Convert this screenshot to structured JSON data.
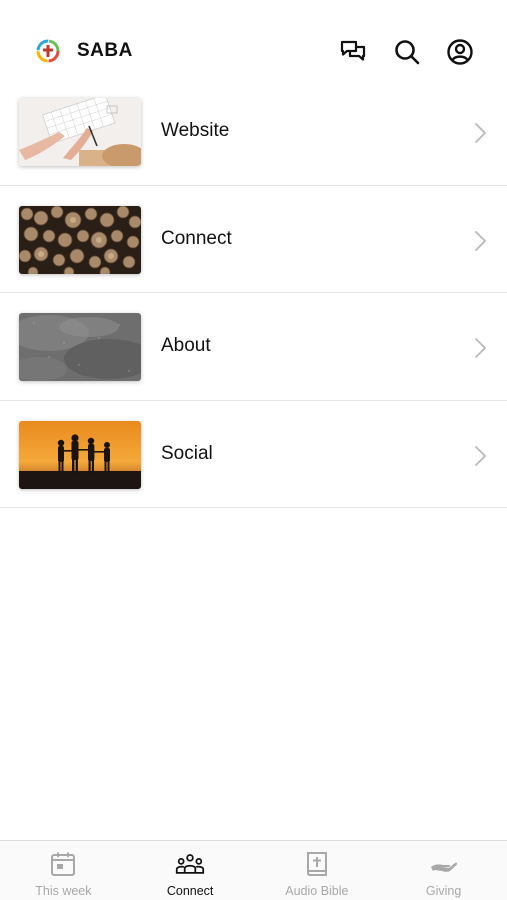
{
  "header": {
    "brand": "SABA",
    "icons": [
      "chat-icon",
      "search-icon",
      "profile-icon"
    ]
  },
  "menu": {
    "items": [
      {
        "label": "Website",
        "image": "hands-typing-keyboard-photo"
      },
      {
        "label": "Connect",
        "image": "stacked-logs-photo"
      },
      {
        "label": "About",
        "image": "gray-stone-texture-photo"
      },
      {
        "label": "Social",
        "image": "family-silhouette-sunset-photo"
      }
    ]
  },
  "tabbar": {
    "tabs": [
      {
        "label": "This week",
        "icon": "calendar-icon",
        "active": false
      },
      {
        "label": "Connect",
        "icon": "group-icon",
        "active": true
      },
      {
        "label": "Audio Bible",
        "icon": "bible-icon",
        "active": false
      },
      {
        "label": "Giving",
        "icon": "giving-hand-icon",
        "active": false
      }
    ]
  },
  "colors": {
    "active_tab": "#111111",
    "inactive_tab": "#a8a8a8",
    "divider": "#e6e6e6"
  }
}
